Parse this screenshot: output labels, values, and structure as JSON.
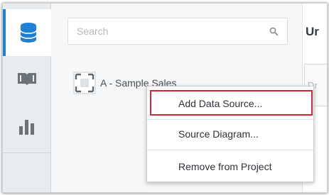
{
  "rail": {
    "items": [
      {
        "icon": "database-icon",
        "active": true
      },
      {
        "icon": "book-icon",
        "active": false
      },
      {
        "icon": "bar-chart-icon",
        "active": false
      }
    ]
  },
  "panel": {
    "search_placeholder": "Search",
    "source_label": "A - Sample Sales"
  },
  "header": {
    "title_partial": "Ur",
    "side_tab_partial": "Dr"
  },
  "context_menu": {
    "items": [
      {
        "label": "Add Data Source...",
        "highlighted": true
      },
      {
        "label": "Source Diagram...",
        "highlighted": false
      },
      {
        "label": "Remove from Project",
        "highlighted": false
      }
    ]
  },
  "colors": {
    "accent": "#1f7fd5",
    "highlight_border": "#d6262c"
  }
}
